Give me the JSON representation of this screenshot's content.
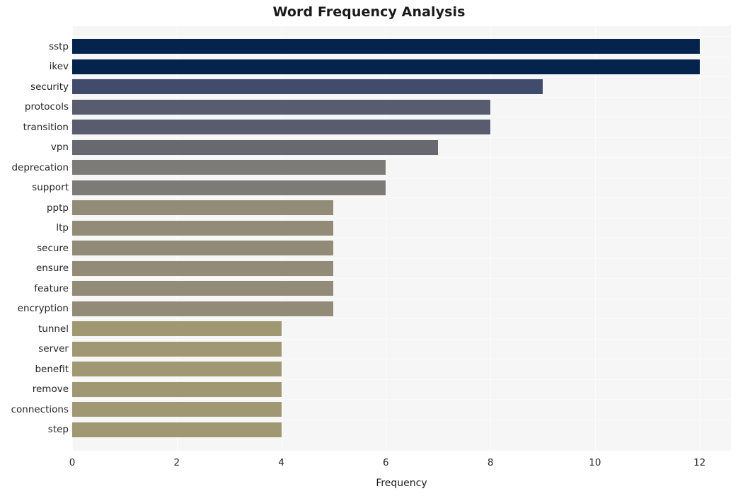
{
  "chart_data": {
    "type": "bar",
    "orientation": "horizontal",
    "title": "Word Frequency Analysis",
    "xlabel": "Frequency",
    "ylabel": "",
    "xlim": [
      0,
      12.6
    ],
    "ylim": [
      0,
      20
    ],
    "xticks": [
      0,
      2,
      4,
      6,
      8,
      10,
      12
    ],
    "xtick_labels": [
      "0",
      "2",
      "4",
      "6",
      "8",
      "10",
      "12"
    ],
    "grid": true,
    "grid_axis": "both",
    "legend": null,
    "categories": [
      "sstp",
      "ikev",
      "security",
      "protocols",
      "transition",
      "vpn",
      "deprecation",
      "support",
      "pptp",
      "ltp",
      "secure",
      "ensure",
      "feature",
      "encryption",
      "tunnel",
      "server",
      "benefit",
      "remove",
      "connections",
      "step"
    ],
    "values": [
      12,
      12,
      9,
      8,
      8,
      7,
      6,
      6,
      5,
      5,
      5,
      5,
      5,
      5,
      4,
      4,
      4,
      4,
      4,
      4
    ],
    "bar_colors": [
      "#04244d",
      "#04244d",
      "#414b6b",
      "#585c6e",
      "#585c6e",
      "#676870",
      "#7c7b78",
      "#7c7b78",
      "#918b77",
      "#918b77",
      "#918b77",
      "#918b77",
      "#918b77",
      "#918b77",
      "#a09872",
      "#a09872",
      "#a09872",
      "#a09872",
      "#a09872",
      "#a09872"
    ],
    "plot_background": "#f6f6f7",
    "figure_background": "#ffffff",
    "title_color": "#1a1a1a",
    "tick_color": "#262626"
  }
}
